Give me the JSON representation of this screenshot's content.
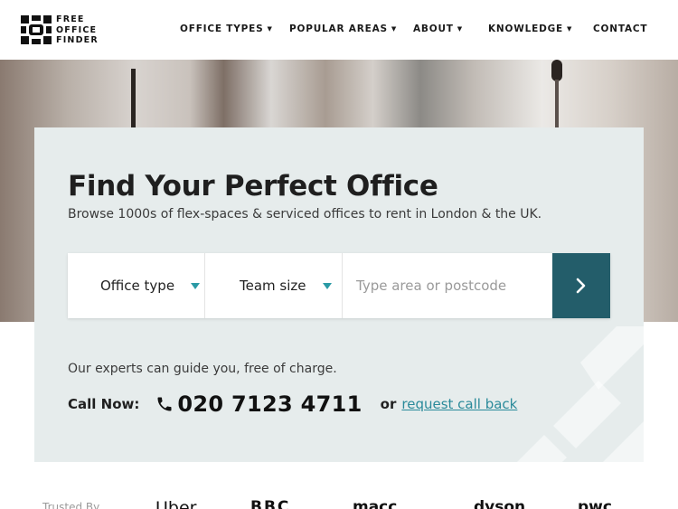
{
  "header": {
    "logo_lines": [
      "FREE",
      "OFFICE",
      "FINDER"
    ],
    "nav": [
      {
        "label": "OFFICE TYPES",
        "has_dropdown": true
      },
      {
        "label": "POPULAR AREAS",
        "has_dropdown": true
      },
      {
        "label": "ABOUT",
        "has_dropdown": true
      },
      {
        "label": "KNOWLEDGE",
        "has_dropdown": true
      },
      {
        "label": "CONTACT",
        "has_dropdown": false
      }
    ]
  },
  "hero": {
    "title": "Find Your Perfect Office",
    "subtitle": "Browse 1000s of flex-spaces & serviced offices to rent in London & the UK."
  },
  "search": {
    "office_type_label": "Office type",
    "team_size_label": "Team size",
    "location_placeholder": "Type area or postcode",
    "location_value": "",
    "submit_icon": "chevron-right-icon"
  },
  "contact": {
    "guide_text": "Our experts can guide you, free of charge.",
    "call_label": "Call Now:",
    "phone_icon": "phone-icon",
    "phone_number": "020 7123 4711",
    "or_text": "or",
    "callback_link": "request call back"
  },
  "trusted": {
    "label": "Trusted By",
    "brands": [
      "Uber",
      "BBC",
      "macc",
      "dyson",
      "pwc"
    ]
  },
  "colors": {
    "accent_teal": "#2a9aa5",
    "button_dark_teal": "#235d6a",
    "card_background": "#e6ecec",
    "link": "#2a8a9a"
  }
}
